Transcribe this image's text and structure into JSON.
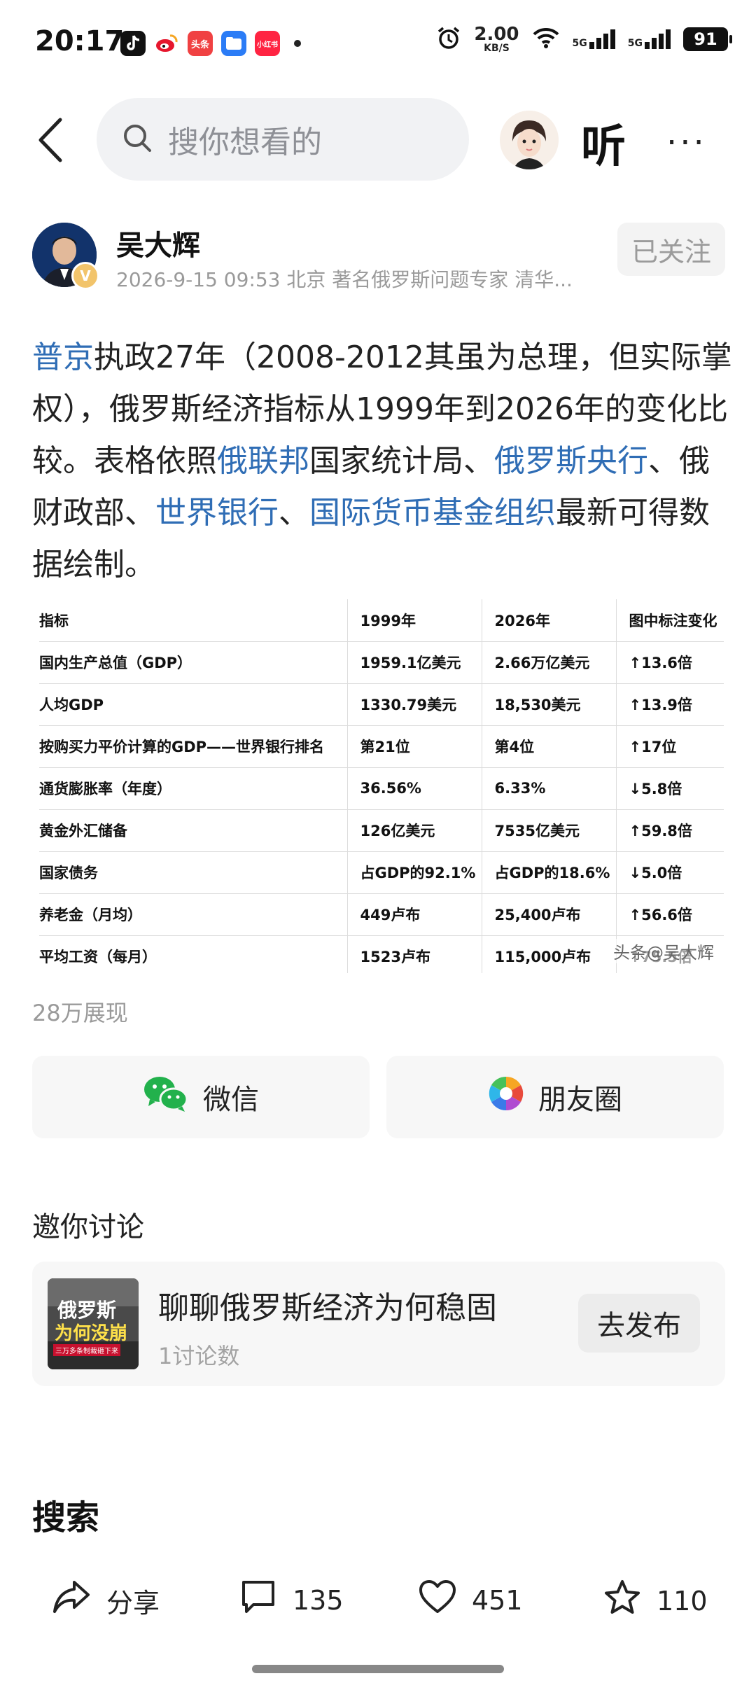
{
  "status_bar": {
    "time": "20:17",
    "app_icons": [
      "tiktok-icon",
      "weibo-icon",
      "toutiao-icon",
      "files-icon",
      "xiaohongshu-icon"
    ],
    "toutiao_label": "头条",
    "xhs_label": "小红书",
    "net_speed_value": "2.00",
    "net_speed_unit": "KB/S",
    "sig1_label": "5G",
    "sig2_label": "5G",
    "battery": "91"
  },
  "header": {
    "search_placeholder": "搜你想看的",
    "listen_label": "听",
    "more_label": "···"
  },
  "author": {
    "name": "吴大辉",
    "verified_label": "V",
    "meta": "2026-9-15 09:53 北京 著名俄罗斯问题专家 清华...",
    "follow_label": "已关注"
  },
  "article": {
    "s1_link": "普京",
    "s2": "执政27年（2008-2012其虽为总理，但实际掌权），俄罗斯经济指标从1999年到2026年的变化比较。表格依照",
    "s3_link": "俄联邦",
    "s4": "国家统计局、",
    "s5_link": "俄罗斯央行",
    "s6": "、俄财政部、",
    "s7_link": "世界银行",
    "s8": "、",
    "s9_link": "国际货币基金组织",
    "s10": "最新可得数据绘制。"
  },
  "table": {
    "headers": [
      "指标",
      "1999年",
      "2026年",
      "图中标注变化"
    ],
    "rows": [
      [
        "国内生产总值（GDP）",
        "1959.1亿美元",
        "2.66万亿美元",
        "↑13.6倍"
      ],
      [
        "人均GDP",
        "1330.79美元",
        "18,530美元",
        "↑13.9倍"
      ],
      [
        "按购买力平价计算的GDP——世界银行排名",
        "第21位",
        "第4位",
        "↑17位"
      ],
      [
        "通货膨胀率（年度）",
        "36.56%",
        "6.33%",
        "↓5.8倍"
      ],
      [
        "黄金外汇储备",
        "126亿美元",
        "7535亿美元",
        "↑59.8倍"
      ],
      [
        "国家债务",
        "占GDP的92.1%",
        "占GDP的18.6%",
        "↓5.0倍"
      ],
      [
        "养老金（月均）",
        "449卢布",
        "25,400卢布",
        "↑56.6倍"
      ],
      [
        "平均工资（每月）",
        "1523卢布",
        "115,000卢布",
        "↑75.5倍"
      ]
    ],
    "watermark": "头条@吴大辉"
  },
  "views": "28万展现",
  "share": {
    "wechat_label": "微信",
    "moments_label": "朋友圈"
  },
  "invite": {
    "title": "邀你讨论",
    "topic_title": "聊聊俄罗斯经济为何稳固",
    "topic_count": "1讨论数",
    "publish_label": "去发布",
    "thumb_line1": "俄罗斯",
    "thumb_line2": "为何没崩",
    "thumb_line3": "三万多条制裁砸下来"
  },
  "search_section": {
    "title": "搜索"
  },
  "bottom_bar": {
    "share_label": "分享",
    "comments": "135",
    "likes": "451",
    "favorites": "110"
  },
  "colors": {
    "link": "#2f6db5",
    "background": "#ffffff",
    "card_bg": "#f7f7f7"
  }
}
